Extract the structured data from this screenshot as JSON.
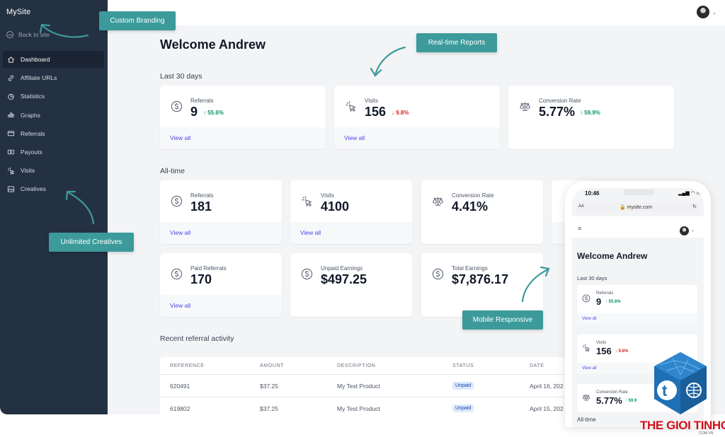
{
  "sidebar": {
    "brand": "MySite",
    "back_label": "Back to site",
    "items": [
      {
        "label": "Dashboard",
        "icon": "home-icon",
        "active": true
      },
      {
        "label": "Affiliate URLs",
        "icon": "link-icon"
      },
      {
        "label": "Statistics",
        "icon": "pie-chart-icon"
      },
      {
        "label": "Graphs",
        "icon": "bar-chart-icon"
      },
      {
        "label": "Referrals",
        "icon": "card-icon"
      },
      {
        "label": "Payouts",
        "icon": "cash-icon"
      },
      {
        "label": "Visits",
        "icon": "cursor-click-icon"
      },
      {
        "label": "Creatives",
        "icon": "image-icon"
      }
    ]
  },
  "header": {
    "avatar": "user-avatar",
    "chevron": "⌄"
  },
  "main": {
    "title": "Welcome Andrew",
    "last30_heading": "Last 30 days",
    "last30": [
      {
        "label": "Referrals",
        "value": "9",
        "change": "55.6%",
        "direction": "up",
        "view_all": "View all"
      },
      {
        "label": "Visits",
        "value": "156",
        "change": "9.8%",
        "direction": "down",
        "view_all": "View all"
      },
      {
        "label": "Conversion Rate",
        "value": "5.77%",
        "change": "59.9%",
        "direction": "up"
      }
    ],
    "alltime_heading": "All-time",
    "alltime": [
      {
        "label": "Referrals",
        "value": "181",
        "view_all": "View all"
      },
      {
        "label": "Visits",
        "value": "4100",
        "view_all": "View all"
      },
      {
        "label": "Conversion Rate",
        "value": "4.41%"
      },
      {
        "label": "Paid Referrals",
        "value": "170",
        "view_all": "View all"
      },
      {
        "label": "Unpaid Earnings",
        "value": "$497.25"
      },
      {
        "label": "Total Earnings",
        "value": "$7,876.17"
      }
    ],
    "activity_heading": "Recent referral activity",
    "table": {
      "columns": [
        "REFERENCE",
        "AMOUNT",
        "DESCRIPTION",
        "STATUS",
        "DATE"
      ],
      "rows": [
        {
          "reference": "620491",
          "amount": "$37.25",
          "description": "My Test Product",
          "status": "Unpaid",
          "date": "April 16, 202"
        },
        {
          "reference": "619802",
          "amount": "$37.25",
          "description": "My Test Product",
          "status": "Unpaid",
          "date": "April 15, 202"
        }
      ]
    }
  },
  "callouts": {
    "branding": "Custom Branding",
    "reports": "Real-time Reports",
    "creatives": "Unlimited Creatives",
    "mobile": "Mobile Responsive"
  },
  "phone": {
    "time": "10:46",
    "status_icons": "▂▄▆ ◠ ▭",
    "aa": "AA",
    "url": "🔒 mysite.com",
    "reload": "↻",
    "menu": "≡",
    "title": "Welcome Andrew",
    "last30_heading": "Last 30 days",
    "cards": [
      {
        "label": "Referrals",
        "value": "9",
        "change": "55.6%",
        "direction": "up",
        "view_all": "View all"
      },
      {
        "label": "Visits",
        "value": "156",
        "change": "9.8%",
        "direction": "down",
        "view_all": "View all"
      },
      {
        "label": "Conversion Rate",
        "value": "5.77%",
        "change": "59.9",
        "direction": "up"
      }
    ],
    "alltime_heading": "All-time"
  },
  "watermark": {
    "text": "THE GIOI TINHOC",
    "sub": ".COM.VN"
  },
  "colors": {
    "sidebar": "#243142",
    "accent": "#3c9a9b",
    "link": "#4f46e5",
    "up": "#059669",
    "down": "#dc2626",
    "watermark": "#d1121a"
  }
}
